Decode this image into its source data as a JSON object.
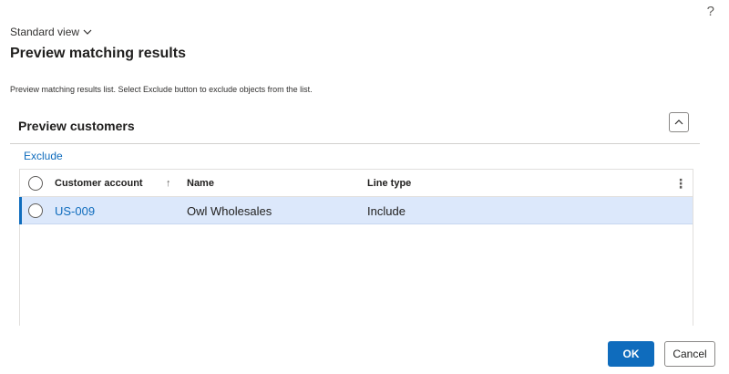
{
  "help": {
    "icon": "question-mark-icon",
    "label": "?"
  },
  "view": {
    "label": "Standard view",
    "icon": "chevron-down-icon"
  },
  "page": {
    "title": "Preview matching results",
    "description": "Preview matching results list. Select Exclude button to exclude objects from the list."
  },
  "section": {
    "title": "Preview customers",
    "collapse_icon": "chevron-up-icon"
  },
  "toolbar": {
    "exclude_label": "Exclude"
  },
  "grid": {
    "columns": {
      "account": "Customer account",
      "sort_indicator": "↑",
      "name": "Name",
      "line_type": "Line type",
      "more": "⋮"
    },
    "rows": [
      {
        "account": "US-009",
        "name": "Owl Wholesales",
        "line_type": "Include",
        "selected": true
      }
    ]
  },
  "actions": {
    "ok_label": "OK",
    "cancel_label": "Cancel"
  },
  "colors": {
    "accent": "#0f6cbd",
    "selected_row": "#dce8fb"
  }
}
